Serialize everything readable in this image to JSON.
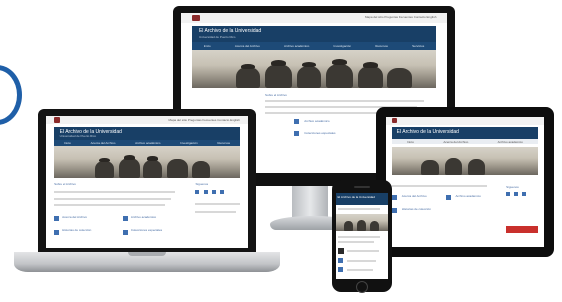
{
  "site": {
    "title_desktop": "El Archivo de la Universidad",
    "title_laptop": "El Archivo de la Universidad",
    "title_tablet": "El Archivo de la Universidad",
    "title_phone": "El Archivo de la Universidad",
    "top_links": "Mapa del sitio  Preguntas frecuentes  Contacto  English",
    "subtitle": "Universidad de Puerto Rico",
    "nav": [
      "Inicio",
      "Acerca del Archivo",
      "Archivo académico",
      "Investigación",
      "Recursos",
      "Servicios"
    ],
    "section_desktop": "Sobre el Archivo",
    "section_laptop": "Sobre el Archivo",
    "links": [
      "Acerca del Archivo",
      "Archivo académico",
      "Historias de colección",
      "Colecciones especiales"
    ],
    "social_label": "Síguenos"
  },
  "colors": {
    "banner": "#183f66",
    "nav": "#1d4a77",
    "accent": "#3f6fb0",
    "arc": "#1f5fa8"
  }
}
